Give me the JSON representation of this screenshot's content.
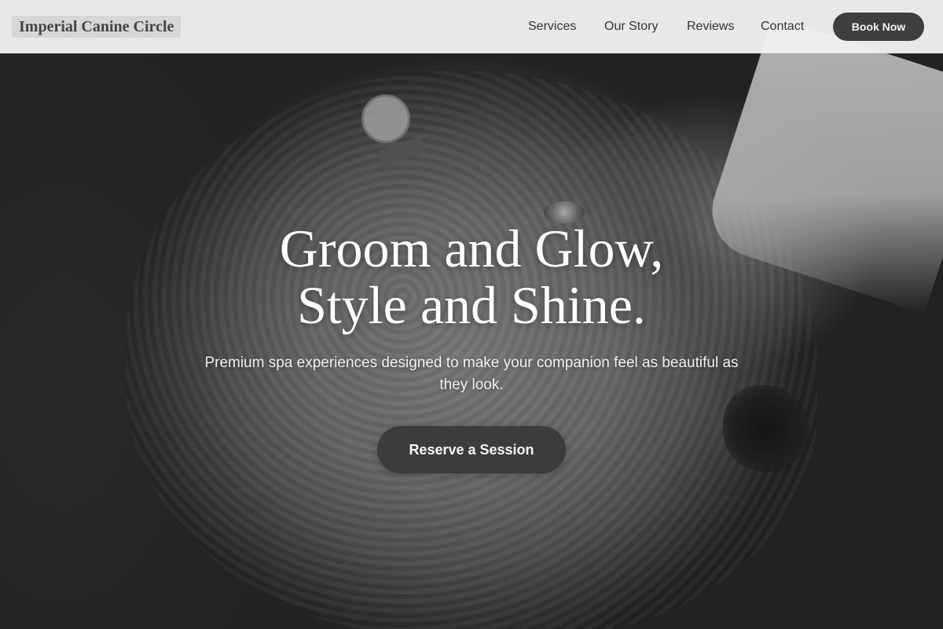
{
  "header": {
    "brand": "Imperial Canine Circle",
    "nav": [
      "Services",
      "Our Story",
      "Reviews",
      "Contact"
    ],
    "cta_label": "Book Now"
  },
  "hero": {
    "headline_line1": "Groom and Glow,",
    "headline_line2": "Style and Shine.",
    "subheadline": "Premium spa experiences designed to make your companion feel as beautiful as they look.",
    "cta_label": "Reserve a Session",
    "image_desc": "sheep"
  },
  "colors": {
    "header_bg": "#f0f0f0",
    "button_bg": "#3f3f3f",
    "button_text": "#f2f2f2",
    "hero_text": "#ffffff"
  }
}
